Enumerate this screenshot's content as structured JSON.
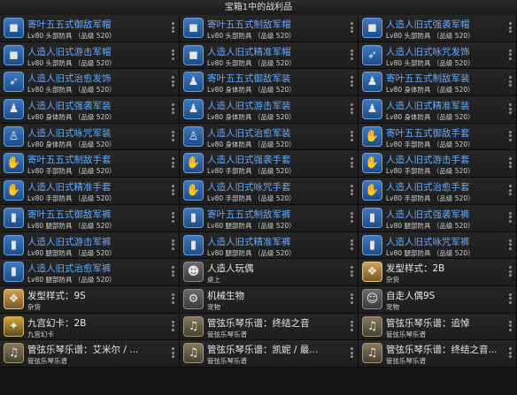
{
  "window": {
    "title": "宝箱1中的战利品"
  },
  "items": [
    {
      "name": "寄叶五五式御敌军帽",
      "sub": "Lv80 头部防具 （品级 520）",
      "color": "blue",
      "icon": "goggles-icon",
      "glyph": "◼",
      "kind": "equip"
    },
    {
      "name": "寄叶五五式制敌军帽",
      "sub": "Lv80 头部防具 （品级 520）",
      "color": "blue",
      "icon": "goggles-icon",
      "glyph": "◼",
      "kind": "equip"
    },
    {
      "name": "人造人旧式强袭军帽",
      "sub": "Lv80 头部防具 （品级 520）",
      "color": "blue",
      "icon": "goggles-icon",
      "glyph": "◼",
      "kind": "equip"
    },
    {
      "name": "人造人旧式游击军帽",
      "sub": "Lv80 头部防具 （品级 520）",
      "color": "blue",
      "icon": "goggles-icon",
      "glyph": "◼",
      "kind": "equip"
    },
    {
      "name": "人造人旧式精准军帽",
      "sub": "Lv80 头部防具 （品级 520）",
      "color": "blue",
      "icon": "goggles-icon",
      "glyph": "◼",
      "kind": "equip"
    },
    {
      "name": "人造人旧式咏咒发饰",
      "sub": "Lv80 头部防具 （品级 520）",
      "color": "blue",
      "icon": "feather-icon",
      "glyph": "➶",
      "kind": "equip"
    },
    {
      "name": "人造人旧式治愈发饰",
      "sub": "Lv80 头部防具 （品级 520）",
      "color": "blue",
      "icon": "feather-icon",
      "glyph": "➶",
      "kind": "equip"
    },
    {
      "name": "寄叶五五式御敌军装",
      "sub": "Lv80 身体防具 （品级 520）",
      "color": "blue",
      "icon": "body-armor-icon",
      "glyph": "♟",
      "kind": "equip"
    },
    {
      "name": "寄叶五五式制敌军装",
      "sub": "Lv80 身体防具 （品级 520）",
      "color": "blue",
      "icon": "body-armor-icon",
      "glyph": "♟",
      "kind": "equip"
    },
    {
      "name": "人造人旧式强袭军装",
      "sub": "Lv80 身体防具 （品级 520）",
      "color": "blue",
      "icon": "body-armor-icon",
      "glyph": "♟",
      "kind": "equip"
    },
    {
      "name": "人造人旧式游击军装",
      "sub": "Lv80 身体防具 （品级 520）",
      "color": "blue",
      "icon": "body-armor-icon",
      "glyph": "♟",
      "kind": "equip"
    },
    {
      "name": "人造人旧式精准军装",
      "sub": "Lv80 身体防具 （品级 520）",
      "color": "blue",
      "icon": "body-armor-icon",
      "glyph": "♟",
      "kind": "equip"
    },
    {
      "name": "人造人旧式咏咒军装",
      "sub": "Lv80 身体防具 （品级 520）",
      "color": "blue",
      "icon": "robe-icon",
      "glyph": "♙",
      "kind": "equip"
    },
    {
      "name": "人造人旧式治愈军装",
      "sub": "Lv80 身体防具 （品级 520）",
      "color": "blue",
      "icon": "robe-icon",
      "glyph": "♙",
      "kind": "equip"
    },
    {
      "name": "寄叶五五式御敌手套",
      "sub": "Lv80 手部防具 （品级 520）",
      "color": "blue",
      "icon": "glove-icon",
      "glyph": "✋",
      "kind": "equip"
    },
    {
      "name": "寄叶五五式制敌手套",
      "sub": "Lv80 手部防具 （品级 520）",
      "color": "blue",
      "icon": "glove-icon",
      "glyph": "✋",
      "kind": "equip"
    },
    {
      "name": "人造人旧式强袭手套",
      "sub": "Lv80 手部防具 （品级 520）",
      "color": "blue",
      "icon": "glove-icon",
      "glyph": "✋",
      "kind": "equip"
    },
    {
      "name": "人造人旧式游击手套",
      "sub": "Lv80 手部防具 （品级 520）",
      "color": "blue",
      "icon": "glove-icon",
      "glyph": "✋",
      "kind": "equip"
    },
    {
      "name": "人造人旧式精准手套",
      "sub": "Lv80 手部防具 （品级 520）",
      "color": "blue",
      "icon": "glove-icon",
      "glyph": "✋",
      "kind": "equip"
    },
    {
      "name": "人造人旧式咏咒手套",
      "sub": "Lv80 手部防具 （品级 520）",
      "color": "blue",
      "icon": "glove-icon",
      "glyph": "✋",
      "kind": "equip"
    },
    {
      "name": "人造人旧式治愈手套",
      "sub": "Lv80 手部防具 （品级 520）",
      "color": "blue",
      "icon": "glove-icon",
      "glyph": "✋",
      "kind": "equip"
    },
    {
      "name": "寄叶五五式御敌军裤",
      "sub": "Lv80 腿部防具 （品级 520）",
      "color": "blue",
      "icon": "trousers-icon",
      "glyph": "▮",
      "kind": "equip"
    },
    {
      "name": "寄叶五五式制敌军裤",
      "sub": "Lv80 腿部防具 （品级 520）",
      "color": "blue",
      "icon": "trousers-icon",
      "glyph": "▮",
      "kind": "equip"
    },
    {
      "name": "人造人旧式强袭军裤",
      "sub": "Lv80 腿部防具 （品级 520）",
      "color": "blue",
      "icon": "trousers-icon",
      "glyph": "▮",
      "kind": "equip"
    },
    {
      "name": "人造人旧式游击军裤",
      "sub": "Lv80 腿部防具 （品级 520）",
      "color": "blue",
      "icon": "trousers-icon",
      "glyph": "▮",
      "kind": "equip"
    },
    {
      "name": "人造人旧式精准军裤",
      "sub": "Lv80 腿部防具 （品级 520）",
      "color": "blue",
      "icon": "trousers-icon",
      "glyph": "▮",
      "kind": "equip"
    },
    {
      "name": "人造人旧式咏咒军裤",
      "sub": "Lv80 腿部防具 （品级 520）",
      "color": "blue",
      "icon": "trousers-icon",
      "glyph": "▮",
      "kind": "equip"
    },
    {
      "name": "人造人旧式治愈军裤",
      "sub": "Lv80 腿部防具 （品级 520）",
      "color": "blue",
      "icon": "trousers-icon",
      "glyph": "▮",
      "kind": "equip"
    },
    {
      "name": "人造人玩偶",
      "sub": "桌上",
      "color": "white",
      "icon": "doll-icon",
      "glyph": "☻",
      "kind": "misc"
    },
    {
      "name": "发型样式：2B",
      "sub": "杂货",
      "color": "white",
      "icon": "hairstyle-icon",
      "glyph": "❖",
      "kind": "gold"
    },
    {
      "name": "发型样式：9S",
      "sub": "杂货",
      "color": "white",
      "icon": "hairstyle-icon",
      "glyph": "❖",
      "kind": "gold"
    },
    {
      "name": "机械生物",
      "sub": "宠物",
      "color": "white",
      "icon": "machine-pet-icon",
      "glyph": "⚙",
      "kind": "misc"
    },
    {
      "name": "自走人偶9S",
      "sub": "宠物",
      "color": "white",
      "icon": "android-pet-icon",
      "glyph": "☺",
      "kind": "misc"
    },
    {
      "name": "九宫幻卡：2B",
      "sub": "九宫幻卡",
      "color": "white",
      "icon": "triple-triad-card-icon",
      "glyph": "✦",
      "kind": "card"
    },
    {
      "name": "管弦乐琴乐谱：终结之音",
      "sub": "管弦乐琴乐谱",
      "color": "white",
      "icon": "sheet-music-icon",
      "glyph": "♫",
      "kind": "paper"
    },
    {
      "name": "管弦乐琴乐谱：追悼",
      "sub": "管弦乐琴乐谱",
      "color": "white",
      "icon": "sheet-music-icon",
      "glyph": "♫",
      "kind": "paper"
    },
    {
      "name": "管弦乐琴乐谱：艾米尔 / ...",
      "sub": "管弦乐琴乐谱",
      "color": "white",
      "icon": "sheet-music-icon",
      "glyph": "♫",
      "kind": "paper"
    },
    {
      "name": "管弦乐琴乐谱：凯妮 / 最...",
      "sub": "管弦乐琴乐谱",
      "color": "white",
      "icon": "sheet-music-icon",
      "glyph": "♫",
      "kind": "paper"
    },
    {
      "name": "管弦乐琴乐谱：终结之音...",
      "sub": "管弦乐琴乐谱",
      "color": "white",
      "icon": "sheet-music-icon",
      "glyph": "♫",
      "kind": "paper"
    }
  ]
}
